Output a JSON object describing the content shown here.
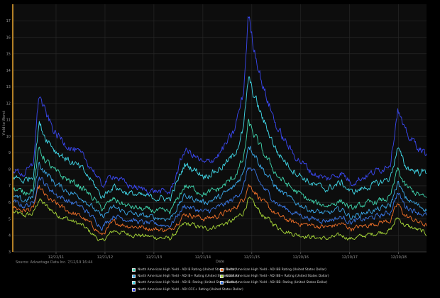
{
  "chart_data": {
    "type": "line",
    "title": "",
    "xlabel": "Date",
    "ylabel": "Yield to Worst",
    "ylim": [
      3,
      18
    ],
    "yticks": [
      "3",
      "4",
      "5",
      "6",
      "7",
      "8",
      "9",
      "10",
      "11",
      "12",
      "13",
      "14",
      "15",
      "16",
      "17"
    ],
    "x_ticks": [
      "12/22/11",
      "12/21/12",
      "12/21/13",
      "12/21/14",
      "12/21/15",
      "12/20/16",
      "12/20/17",
      "12/20/18"
    ],
    "x_tick_values": [
      2011.97,
      2012.97,
      2013.97,
      2014.97,
      2015.97,
      2016.97,
      2017.97,
      2018.97
    ],
    "xlim": [
      2011.1,
      2019.54
    ],
    "grid": true,
    "legend_position": "bottom",
    "source": "Source: Advantage Data Inc. 7/12/19 16:44",
    "background": "#000000",
    "plot_background": "#0d0d0d",
    "axis_accent": "#e0a030",
    "series": [
      {
        "name": "North American High Yield - ADI B Rating (United States Dollar)",
        "color": "#3fd8b0",
        "x": [
          2011.1,
          2011.3,
          2011.5,
          2011.62,
          2011.75,
          2011.85,
          2011.97,
          2012.2,
          2012.5,
          2012.75,
          2012.9,
          2013.15,
          2013.4,
          2013.7,
          2013.95,
          2014.3,
          2014.6,
          2014.8,
          2015.0,
          2015.3,
          2015.6,
          2015.8,
          2015.9,
          2016.0,
          2016.2,
          2016.5,
          2016.8,
          2017.2,
          2017.5,
          2017.8,
          2018.0,
          2018.3,
          2018.6,
          2018.8,
          2018.95,
          2019.1,
          2019.3,
          2019.54
        ],
        "y": [
          6.8,
          6.6,
          6.8,
          9.2,
          8.6,
          8.2,
          7.8,
          7.4,
          6.9,
          6.2,
          5.6,
          6.2,
          5.8,
          5.6,
          5.5,
          5.4,
          7.0,
          6.8,
          6.5,
          6.8,
          7.5,
          8.6,
          10.8,
          10.2,
          9.0,
          7.6,
          6.8,
          6.0,
          5.8,
          6.1,
          5.6,
          5.9,
          6.1,
          6.3,
          8.0,
          7.0,
          6.6,
          6.2
        ]
      },
      {
        "name": "North American High Yield - ADI BB Rating (United States Dollar)",
        "color": "#f07028",
        "x": [
          2011.1,
          2011.3,
          2011.5,
          2011.62,
          2011.75,
          2011.85,
          2011.97,
          2012.2,
          2012.5,
          2012.75,
          2012.9,
          2013.15,
          2013.4,
          2013.7,
          2013.95,
          2014.3,
          2014.6,
          2014.8,
          2015.0,
          2015.3,
          2015.6,
          2015.8,
          2015.9,
          2016.0,
          2016.2,
          2016.5,
          2016.8,
          2017.2,
          2017.5,
          2017.8,
          2018.0,
          2018.3,
          2018.6,
          2018.8,
          2018.95,
          2019.1,
          2019.3,
          2019.54
        ],
        "y": [
          5.7,
          5.5,
          5.6,
          6.9,
          6.4,
          6.1,
          5.9,
          5.5,
          5.1,
          4.5,
          4.0,
          4.8,
          4.6,
          4.5,
          4.4,
          4.3,
          5.3,
          5.2,
          5.0,
          5.2,
          5.6,
          6.2,
          7.1,
          6.8,
          6.0,
          5.2,
          4.8,
          4.6,
          4.5,
          4.7,
          4.4,
          4.6,
          4.8,
          4.9,
          5.9,
          5.2,
          4.9,
          4.6
        ]
      },
      {
        "name": "North American High Yield - ADI B+ Rating (United States Dollar)",
        "color": "#3aa8e8",
        "x": [
          2011.1,
          2011.3,
          2011.5,
          2011.62,
          2011.75,
          2011.85,
          2011.97,
          2012.2,
          2012.5,
          2012.75,
          2012.9,
          2013.15,
          2013.4,
          2013.7,
          2013.95,
          2014.3,
          2014.6,
          2014.8,
          2015.0,
          2015.3,
          2015.6,
          2015.8,
          2015.9,
          2016.0,
          2016.2,
          2016.5,
          2016.8,
          2017.2,
          2017.5,
          2017.8,
          2018.0,
          2018.3,
          2018.6,
          2018.8,
          2018.95,
          2019.1,
          2019.3,
          2019.54
        ],
        "y": [
          6.3,
          6.1,
          6.3,
          8.4,
          7.8,
          7.5,
          7.1,
          6.7,
          6.3,
          5.6,
          5.1,
          5.7,
          5.4,
          5.2,
          5.1,
          5.0,
          6.4,
          6.2,
          6.0,
          6.3,
          6.9,
          7.8,
          9.6,
          9.1,
          8.0,
          6.8,
          6.1,
          5.5,
          5.3,
          5.6,
          5.1,
          5.4,
          5.6,
          5.8,
          7.2,
          6.3,
          5.9,
          5.6
        ]
      },
      {
        "name": "North American High Yield - ADI BB+ Rating (United States Dollar)",
        "color": "#a8d838",
        "x": [
          2011.1,
          2011.3,
          2011.5,
          2011.62,
          2011.75,
          2011.85,
          2011.97,
          2012.2,
          2012.5,
          2012.75,
          2012.9,
          2013.15,
          2013.4,
          2013.7,
          2013.95,
          2014.3,
          2014.6,
          2014.8,
          2015.0,
          2015.3,
          2015.6,
          2015.8,
          2015.9,
          2016.0,
          2016.2,
          2016.5,
          2016.8,
          2017.2,
          2017.5,
          2017.8,
          2018.0,
          2018.3,
          2018.6,
          2018.8,
          2018.95,
          2019.1,
          2019.3,
          2019.54
        ],
        "y": [
          5.4,
          5.2,
          5.3,
          6.2,
          5.8,
          5.6,
          5.3,
          5.0,
          4.6,
          4.0,
          3.6,
          4.3,
          4.1,
          4.0,
          3.9,
          3.8,
          4.7,
          4.6,
          4.4,
          4.6,
          4.9,
          5.4,
          6.2,
          5.9,
          5.2,
          4.5,
          4.1,
          3.9,
          3.8,
          4.0,
          3.8,
          4.0,
          4.2,
          4.3,
          5.1,
          4.6,
          4.4,
          4.1
        ]
      },
      {
        "name": "North American High Yield - ADI B- Rating (United States Dollar)",
        "color": "#40d8e8",
        "x": [
          2011.1,
          2011.3,
          2011.5,
          2011.62,
          2011.75,
          2011.85,
          2011.97,
          2012.2,
          2012.5,
          2012.75,
          2012.9,
          2013.15,
          2013.4,
          2013.7,
          2013.95,
          2014.3,
          2014.6,
          2014.8,
          2015.0,
          2015.3,
          2015.6,
          2015.8,
          2015.9,
          2016.0,
          2016.2,
          2016.5,
          2016.8,
          2017.2,
          2017.5,
          2017.8,
          2018.0,
          2018.3,
          2018.6,
          2018.8,
          2018.95,
          2019.1,
          2019.3,
          2019.54
        ],
        "y": [
          7.6,
          7.3,
          7.6,
          10.8,
          10.0,
          9.6,
          9.1,
          8.6,
          8.0,
          7.1,
          6.3,
          7.0,
          6.6,
          6.4,
          6.3,
          6.2,
          8.3,
          8.0,
          7.6,
          8.0,
          8.8,
          10.4,
          13.5,
          12.6,
          11.0,
          9.0,
          8.0,
          7.1,
          6.8,
          7.2,
          6.6,
          6.9,
          7.2,
          7.5,
          9.3,
          8.2,
          7.9,
          7.8
        ]
      },
      {
        "name": "North American High Yield - ADI BB- Rating (United States Dollar)",
        "color": "#3a78e8",
        "x": [
          2011.1,
          2011.3,
          2011.5,
          2011.62,
          2011.75,
          2011.85,
          2011.97,
          2012.2,
          2012.5,
          2012.75,
          2012.9,
          2013.15,
          2013.4,
          2013.7,
          2013.95,
          2014.3,
          2014.6,
          2014.8,
          2015.0,
          2015.3,
          2015.6,
          2015.8,
          2015.9,
          2016.0,
          2016.2,
          2016.5,
          2016.8,
          2017.2,
          2017.5,
          2017.8,
          2018.0,
          2018.3,
          2018.6,
          2018.8,
          2018.95,
          2019.1,
          2019.3,
          2019.54
        ],
        "y": [
          6.0,
          5.8,
          5.9,
          7.6,
          7.1,
          6.8,
          6.5,
          6.1,
          5.7,
          5.0,
          4.5,
          5.2,
          5.0,
          4.8,
          4.7,
          4.6,
          5.8,
          5.6,
          5.4,
          5.7,
          6.2,
          6.9,
          8.2,
          7.8,
          6.9,
          5.9,
          5.4,
          5.0,
          4.9,
          5.1,
          4.8,
          5.0,
          5.2,
          5.4,
          6.6,
          5.8,
          5.5,
          5.2
        ]
      },
      {
        "name": "North American High Yield - ADI CCC+ Rating (United States Dollar)",
        "color": "#3a48f0",
        "x": [
          2011.1,
          2011.3,
          2011.5,
          2011.62,
          2011.75,
          2011.85,
          2011.97,
          2012.2,
          2012.5,
          2012.75,
          2012.9,
          2013.15,
          2013.4,
          2013.7,
          2013.95,
          2014.3,
          2014.6,
          2014.8,
          2015.0,
          2015.3,
          2015.6,
          2015.8,
          2015.9,
          2016.0,
          2016.2,
          2016.5,
          2016.8,
          2017.2,
          2017.5,
          2017.8,
          2018.0,
          2018.3,
          2018.6,
          2018.8,
          2018.95,
          2019.1,
          2019.3,
          2019.54
        ],
        "y": [
          8.0,
          7.7,
          8.2,
          12.6,
          11.4,
          10.8,
          10.1,
          9.5,
          8.8,
          7.9,
          7.0,
          7.7,
          7.1,
          6.8,
          6.7,
          6.6,
          9.2,
          8.8,
          8.3,
          8.9,
          10.2,
          12.6,
          17.4,
          15.6,
          13.0,
          10.4,
          9.0,
          7.8,
          7.4,
          7.8,
          7.2,
          7.6,
          8.0,
          8.4,
          11.7,
          10.2,
          9.6,
          8.8
        ]
      }
    ]
  }
}
